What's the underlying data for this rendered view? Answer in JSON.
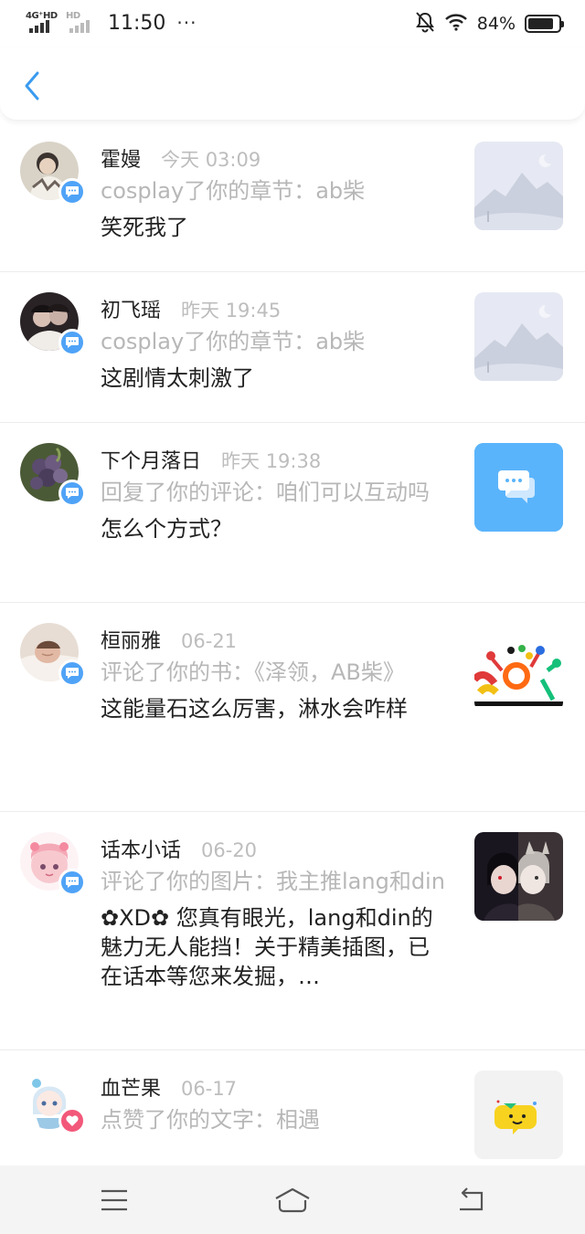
{
  "status_bar": {
    "network_left": "4G⁺HD",
    "network_right": "HD",
    "time": "11:50",
    "dots": "···",
    "battery": "84%",
    "battery_level": 0.84,
    "icons": [
      "signal-icon",
      "bell-off-icon",
      "wifi-icon",
      "battery-icon"
    ]
  },
  "header": {
    "back_icon": "chevron-left-icon"
  },
  "accent_color": "#4fa3f7",
  "notifications": [
    {
      "name": "霍嫚",
      "time": "今天 03:09",
      "action": "cosplay了你的章节：ab柴",
      "message": "笑死我了",
      "badge": "comment-icon",
      "thumb": "placeholder-image-icon"
    },
    {
      "name": "初飞瑶",
      "time": "昨天 19:45",
      "action": "cosplay了你的章节：ab柴",
      "message": "这剧情太刺激了",
      "badge": "comment-icon",
      "thumb": "placeholder-image-icon"
    },
    {
      "name": "下个月落日",
      "time": "昨天 19:38",
      "action": "回复了你的评论：咱们可以互动吗",
      "message": "怎么个方式？",
      "badge": "comment-icon",
      "thumb": "chat-bubble-icon"
    },
    {
      "name": "桓丽雅",
      "time": "06-21",
      "action": "评论了你的书：《泽领，AB柴》",
      "message": "这能量石这么厉害，淋水会咋样",
      "badge": "comment-icon",
      "thumb": "book-cover-image"
    },
    {
      "name": "话本小话",
      "time": "06-20",
      "action": "评论了你的图片：我主推lang和din",
      "message": "✿XD✿ 您真有眼光，lang和din的魅力无人能挡！关于精美插图，已在话本等您来发掘，…",
      "badge": "comment-icon",
      "thumb": "character-art-image"
    },
    {
      "name": "血芒果",
      "time": "06-17",
      "action": "点赞了你的文字：相遇",
      "message": "",
      "badge": "heart-icon",
      "thumb": "chat-emoji-icon"
    }
  ],
  "nav": {
    "menu_icon": "menu-icon",
    "home_icon": "home-icon",
    "back_icon": "back-arrow-icon"
  }
}
